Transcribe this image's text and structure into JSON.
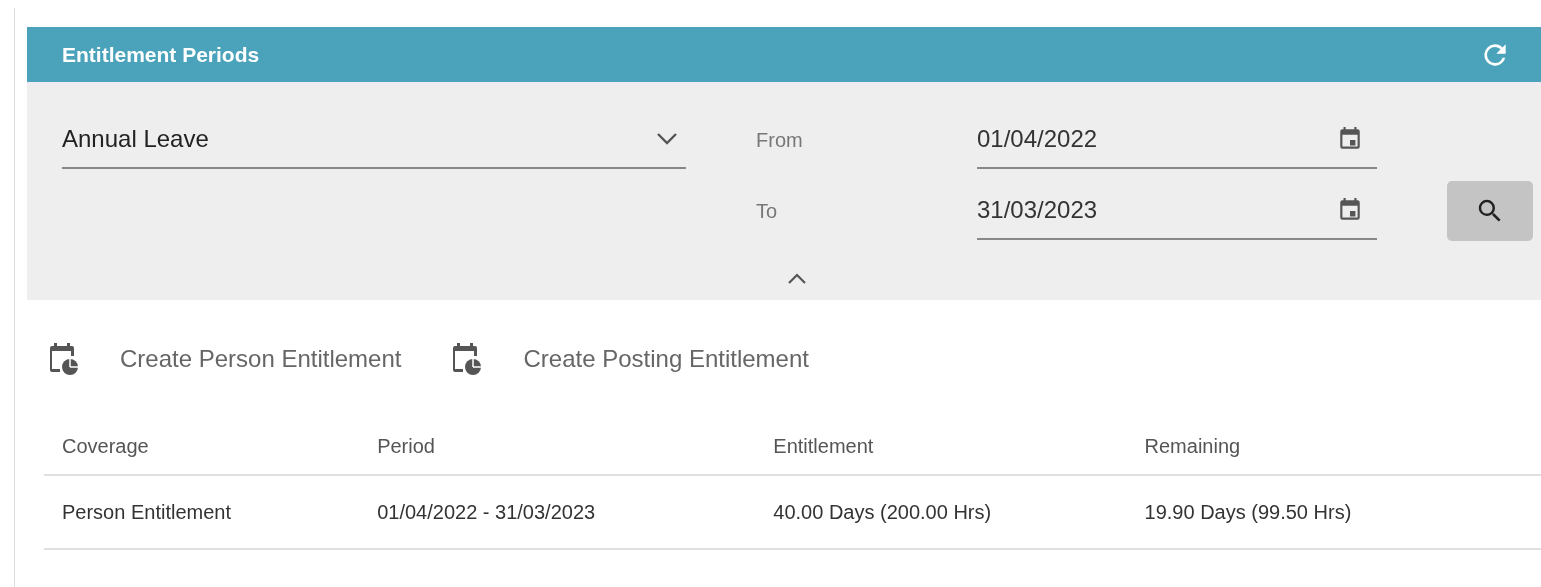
{
  "panel": {
    "title": "Entitlement Periods"
  },
  "filter": {
    "leave_type": "Annual Leave",
    "from_label": "From",
    "from_value": "01/04/2022",
    "to_label": "To",
    "to_value": "31/03/2023"
  },
  "actions": [
    {
      "label": "Create Person Entitlement"
    },
    {
      "label": "Create Posting Entitlement"
    }
  ],
  "table": {
    "columns": [
      "Coverage",
      "Period",
      "Entitlement",
      "Remaining"
    ],
    "rows": [
      [
        "Person Entitlement",
        "01/04/2022 - 31/03/2023",
        "40.00 Days (200.00 Hrs)",
        "19.90 Days (99.50 Hrs)"
      ]
    ]
  }
}
